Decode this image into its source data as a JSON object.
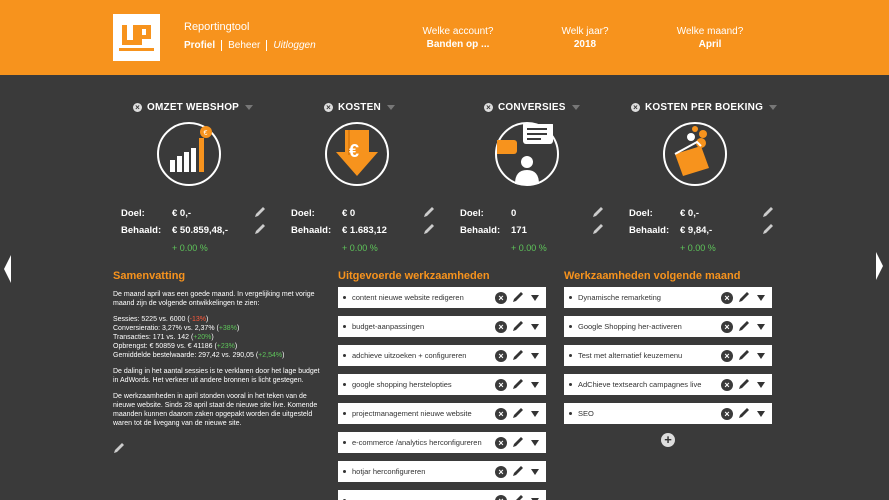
{
  "header": {
    "app_title": "Reportingtool",
    "nav": [
      "Profiel",
      "Beheer",
      "Uitloggen"
    ],
    "account": {
      "label": "Welke account?",
      "value": "Banden op ..."
    },
    "year": {
      "label": "Welk jaar?",
      "value": "2018"
    },
    "month": {
      "label": "Welke maand?",
      "value": "April"
    }
  },
  "kpis": [
    {
      "title": "OMZET WEBSHOP",
      "icon": "bar-chart-euro-icon",
      "goal_label": "Doel:",
      "goal": "€ 0,-",
      "achieved_label": "Behaald:",
      "achieved": "€ 50.859,48,-",
      "delta": "+ 0.00 %"
    },
    {
      "title": "KOSTEN",
      "icon": "euro-down-arrow-icon",
      "goal_label": "Doel:",
      "goal": "€ 0",
      "achieved_label": "Behaald:",
      "achieved": "€ 1.683,12",
      "delta": "+ 0.00 %"
    },
    {
      "title": "CONVERSIES",
      "icon": "chat-person-icon",
      "goal_label": "Doel:",
      "goal": "0",
      "achieved_label": "Behaald:",
      "achieved": "171",
      "delta": "+ 0.00 %"
    },
    {
      "title": "KOSTEN PER BOEKING",
      "icon": "wallet-coins-icon",
      "goal_label": "Doel:",
      "goal": "€ 0,-",
      "achieved_label": "Behaald:",
      "achieved": "€ 9,84,-",
      "delta": "+ 0.00 %"
    }
  ],
  "summary": {
    "title": "Samenvatting",
    "intro": "De maand april was een goede maand.  In vergelijking met vorige maand zijn de volgende ontwikkelingen te zien:",
    "stats": [
      {
        "text": "Sessies: 5225 vs. 6000 (",
        "delta": "-13%",
        "tone": "red"
      },
      {
        "text": "Conversieratio: 3,27% vs. 2,37% (",
        "delta": "+38%",
        "tone": "green"
      },
      {
        "text": "Transacties: 171 vs. 142 (",
        "delta": "+20%",
        "tone": "green"
      },
      {
        "text": "Opbrengst: € 50859 vs. € 41186 (",
        "delta": "+23%",
        "tone": "green"
      },
      {
        "text": "Gemiddelde bestelwaarde: 297,42 vs. 290,05 (",
        "delta": "+2,54%",
        "tone": "green"
      }
    ],
    "para2": "De daling in het aantal sessies is te verklaren door het lage budget in AdWords. Het verkeer uit andere bronnen is licht gestegen.",
    "para3": "De werkzaamheden in april stonden vooral in het teken van de nieuwe website. Sinds 28 april staat de nieuwe site live. Komende maanden kunnen daarom zaken opgepakt worden die uitgesteld waren tot de livegang van de nieuwe site."
  },
  "done": {
    "title": "Uitgevoerde werkzaamheden",
    "items": [
      "content nieuwe website redigeren",
      "budget-aanpassingen",
      "adchieve uitzoeken + configureren",
      "google shopping herstelopties",
      "projectmanagement nieuwe website",
      "e-commerce /analytics herconfigureren",
      "hotjar herconfigureren",
      ""
    ]
  },
  "next": {
    "title": "Werkzaamheden volgende maand",
    "items": [
      "Dynamische remarketing",
      "Google Shopping her-activeren",
      "Test met alternatief keuzemenu",
      "AdChieve textsearch campagnes live",
      "SEO"
    ]
  },
  "colors": {
    "brand": "#f7931d",
    "background": "#3a3a3a",
    "positive": "#5ec55a",
    "negative": "#ff5a3c"
  }
}
